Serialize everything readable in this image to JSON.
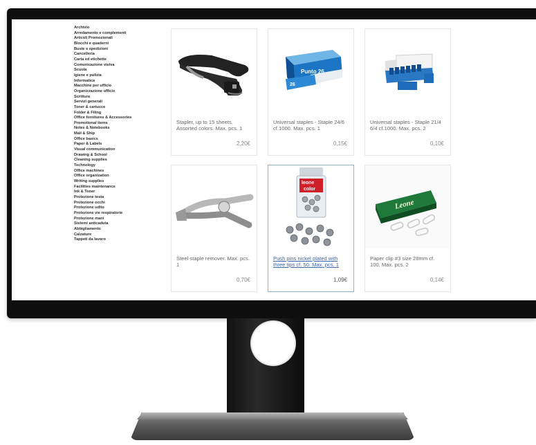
{
  "sidebar": {
    "items": [
      "Archivio",
      "Arredamento e complementi",
      "Articoli Promozionali",
      "Blocchi e quaderni",
      "Buste e spedizioni",
      "Cancelleria",
      "Carta ed etichette",
      "Comunicazione visiva",
      "Scuola",
      "Igiene e pulizia",
      "Informatica",
      "Macchine per ufficio",
      "Organizzazione ufficio",
      "Scrittura",
      "Servizi generali",
      "Toner & cartucce",
      "Folder & Filing",
      "Office fornitures & Accessories",
      "Promotional items",
      "Notes & Notebooks",
      "Mail & Ship",
      "Office basics",
      "Paper & Labels",
      "Visual communication",
      "Drawing & School",
      "Cleaning supplies",
      "Technology",
      "Office machines",
      "Office organization",
      "Writing supplies",
      "Facilities maintenance",
      "Ink & Toner",
      "Protezione testa",
      "Protezione occhi",
      "Protezione udito",
      "Protezione vie respiratorie",
      "Protezione mani",
      "Sistemi anticaduta",
      "Abbigliamento",
      "Calzature",
      "Tappeti da lavoro"
    ]
  },
  "products": [
    {
      "name": "Stapler, up to 15 sheets. Assorted colors. Max. pcs. 1",
      "price": "2,20€",
      "icon": "stapler-icon"
    },
    {
      "name": "Universal staples - Staple 24/6 cf.1000. Max. pcs. 1",
      "price": "0,15€",
      "icon": "staples-box-icon",
      "box_text": "Punto 26"
    },
    {
      "name": "Universal staples - Staple 21/4 6/4 cf.1000. Max. pcs. 2",
      "price": "0,10€",
      "icon": "staples-display-icon"
    },
    {
      "name": "Steel staple remover. Max. pcs. 1",
      "price": "0,70€",
      "icon": "staple-remover-icon"
    },
    {
      "name": "Push pins nickel plated with three tips cf. 50. Max. pcs. 1",
      "price": "1,09€",
      "icon": "push-pins-icon",
      "box_text": "leone color"
    },
    {
      "name": "Paper clip #3 size 28mm cf. 100. Max. pcs. 2",
      "price": "0,14€",
      "icon": "paper-clips-icon",
      "box_text": "Leone"
    }
  ],
  "colors": {
    "accent_link": "#3b66a8",
    "active_border": "#8fb1d4",
    "price": "#8a8a8a"
  }
}
